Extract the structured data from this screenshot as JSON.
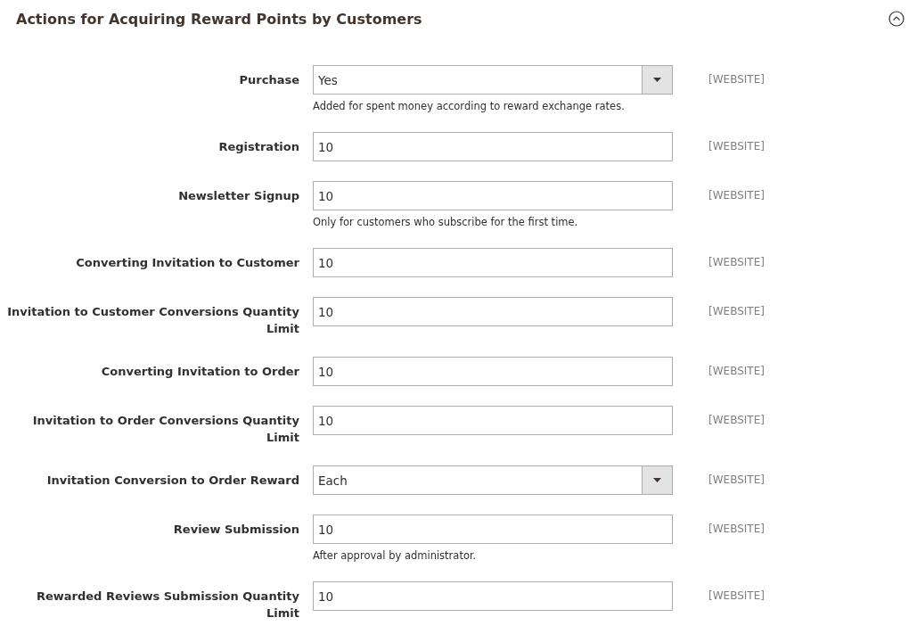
{
  "section": {
    "title": "Actions for Acquiring Reward Points by Customers",
    "expanded": true
  },
  "fields": [
    {
      "label": "Purchase",
      "kind": "select",
      "value": "Yes",
      "note": "Added for spent money according to reward exchange rates.",
      "scope": "[WEBSITE]"
    },
    {
      "label": "Registration",
      "kind": "text",
      "value": "10",
      "scope": "[WEBSITE]"
    },
    {
      "label": "Newsletter Signup",
      "kind": "text",
      "value": "10",
      "note": "Only for customers who subscribe for the first time.",
      "scope": "[WEBSITE]"
    },
    {
      "label": "Converting Invitation to Customer",
      "kind": "text",
      "value": "10",
      "scope": "[WEBSITE]"
    },
    {
      "label": "Invitation to Customer Conversions Quantity Limit",
      "kind": "text",
      "value": "10",
      "scope": "[WEBSITE]"
    },
    {
      "label": "Converting Invitation to Order",
      "kind": "text",
      "value": "10",
      "scope": "[WEBSITE]"
    },
    {
      "label": "Invitation to Order Conversions Quantity Limit",
      "kind": "text",
      "value": "10",
      "scope": "[WEBSITE]"
    },
    {
      "label": "Invitation Conversion to Order Reward",
      "kind": "select",
      "value": "Each",
      "scope": "[WEBSITE]"
    },
    {
      "label": "Review Submission",
      "kind": "text",
      "value": "10",
      "note": "After approval by administrator.",
      "scope": "[WEBSITE]"
    },
    {
      "label": "Rewarded Reviews Submission Quantity Limit",
      "kind": "text",
      "value": "10",
      "scope": "[WEBSITE]"
    }
  ]
}
